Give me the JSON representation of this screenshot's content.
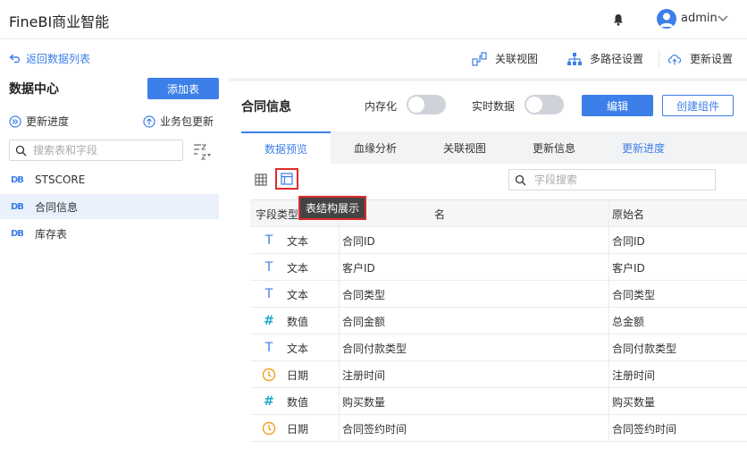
{
  "header": {
    "app_title": "FineBI商业智能",
    "user_name": "admin"
  },
  "left": {
    "back_link": "返回数据列表",
    "title": "数据中心",
    "add_table_label": "添加表",
    "update_progress": "更新进度",
    "biz_update": "业务包更新",
    "search_placeholder": "搜索表和字段",
    "tables": [
      {
        "name": "STSCORE"
      },
      {
        "name": "合同信息"
      },
      {
        "name": "库存表"
      }
    ]
  },
  "toolbar": {
    "relation_view": "关联视图",
    "multipath": "多路径设置",
    "update_settings": "更新设置"
  },
  "card": {
    "title": "合同信息",
    "memory_label": "内存化",
    "realtime_label": "实时数据",
    "edit_label": "编辑",
    "create_label": "创建组件",
    "tabs": [
      "数据预览",
      "血缘分析",
      "关联视图",
      "更新信息",
      "更新进度"
    ],
    "tooltip": "表结构展示",
    "field_search_placeholder": "字段搜索",
    "columns": [
      "字段类型",
      "名",
      "原始名"
    ],
    "rows": [
      {
        "type": "文本",
        "name": "合同ID",
        "orig": "合同ID"
      },
      {
        "type": "文本",
        "name": "客户ID",
        "orig": "客户ID"
      },
      {
        "type": "文本",
        "name": "合同类型",
        "orig": "合同类型"
      },
      {
        "type": "数值",
        "name": "合同金额",
        "orig": "总金额"
      },
      {
        "type": "文本",
        "name": "合同付款类型",
        "orig": "合同付款类型"
      },
      {
        "type": "日期",
        "name": "注册时间",
        "orig": "注册时间"
      },
      {
        "type": "数值",
        "name": "购买数量",
        "orig": "购买数量"
      },
      {
        "type": "日期",
        "name": "合同签约时间",
        "orig": "合同签约时间"
      }
    ]
  }
}
